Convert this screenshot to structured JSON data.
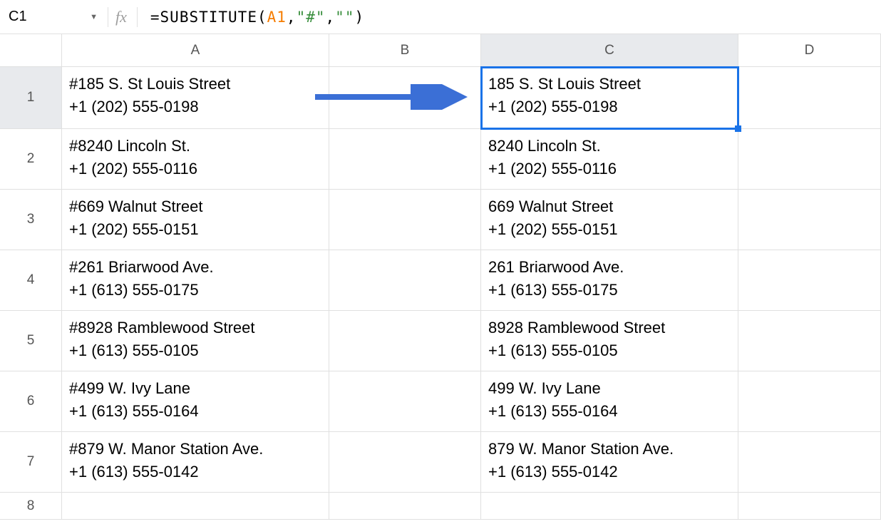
{
  "formula_bar": {
    "cell_ref": "C1",
    "fx_label": "fx",
    "formula_prefix": "=SUBSTITUTE",
    "formula_open": "(",
    "formula_ref": "A1",
    "formula_comma1": ",",
    "formula_str1": "\"#\"",
    "formula_comma2": ",",
    "formula_str2": "\"\"",
    "formula_close": ")"
  },
  "columns": {
    "A": "A",
    "B": "B",
    "C": "C",
    "D": "D"
  },
  "row_labels": [
    "1",
    "2",
    "3",
    "4",
    "5",
    "6",
    "7",
    "8"
  ],
  "rows": [
    {
      "a": "#185 S. St Louis Street\n+1 (202) 555-0198",
      "c": "185 S. St Louis Street\n+1 (202) 555-0198"
    },
    {
      "a": "#8240 Lincoln St.\n+1 (202) 555-0116",
      "c": "8240 Lincoln St.\n+1 (202) 555-0116"
    },
    {
      "a": "#669 Walnut Street\n+1 (202) 555-0151",
      "c": "669 Walnut Street\n+1 (202) 555-0151"
    },
    {
      "a": "#261 Briarwood Ave.\n+1 (613) 555-0175",
      "c": "261 Briarwood Ave.\n+1 (613) 555-0175"
    },
    {
      "a": "#8928 Ramblewood Street\n+1 (613) 555-0105",
      "c": "8928 Ramblewood Street\n+1 (613) 555-0105"
    },
    {
      "a": "#499 W. Ivy Lane\n+1 (613) 555-0164",
      "c": "499 W. Ivy Lane\n+1 (613) 555-0164"
    },
    {
      "a": "#879 W. Manor Station Ave.\n+1 (613) 555-0142",
      "c": "879 W. Manor Station Ave.\n+1 (613) 555-0142"
    },
    {
      "a": "",
      "c": ""
    }
  ],
  "selected_cell": "C1"
}
